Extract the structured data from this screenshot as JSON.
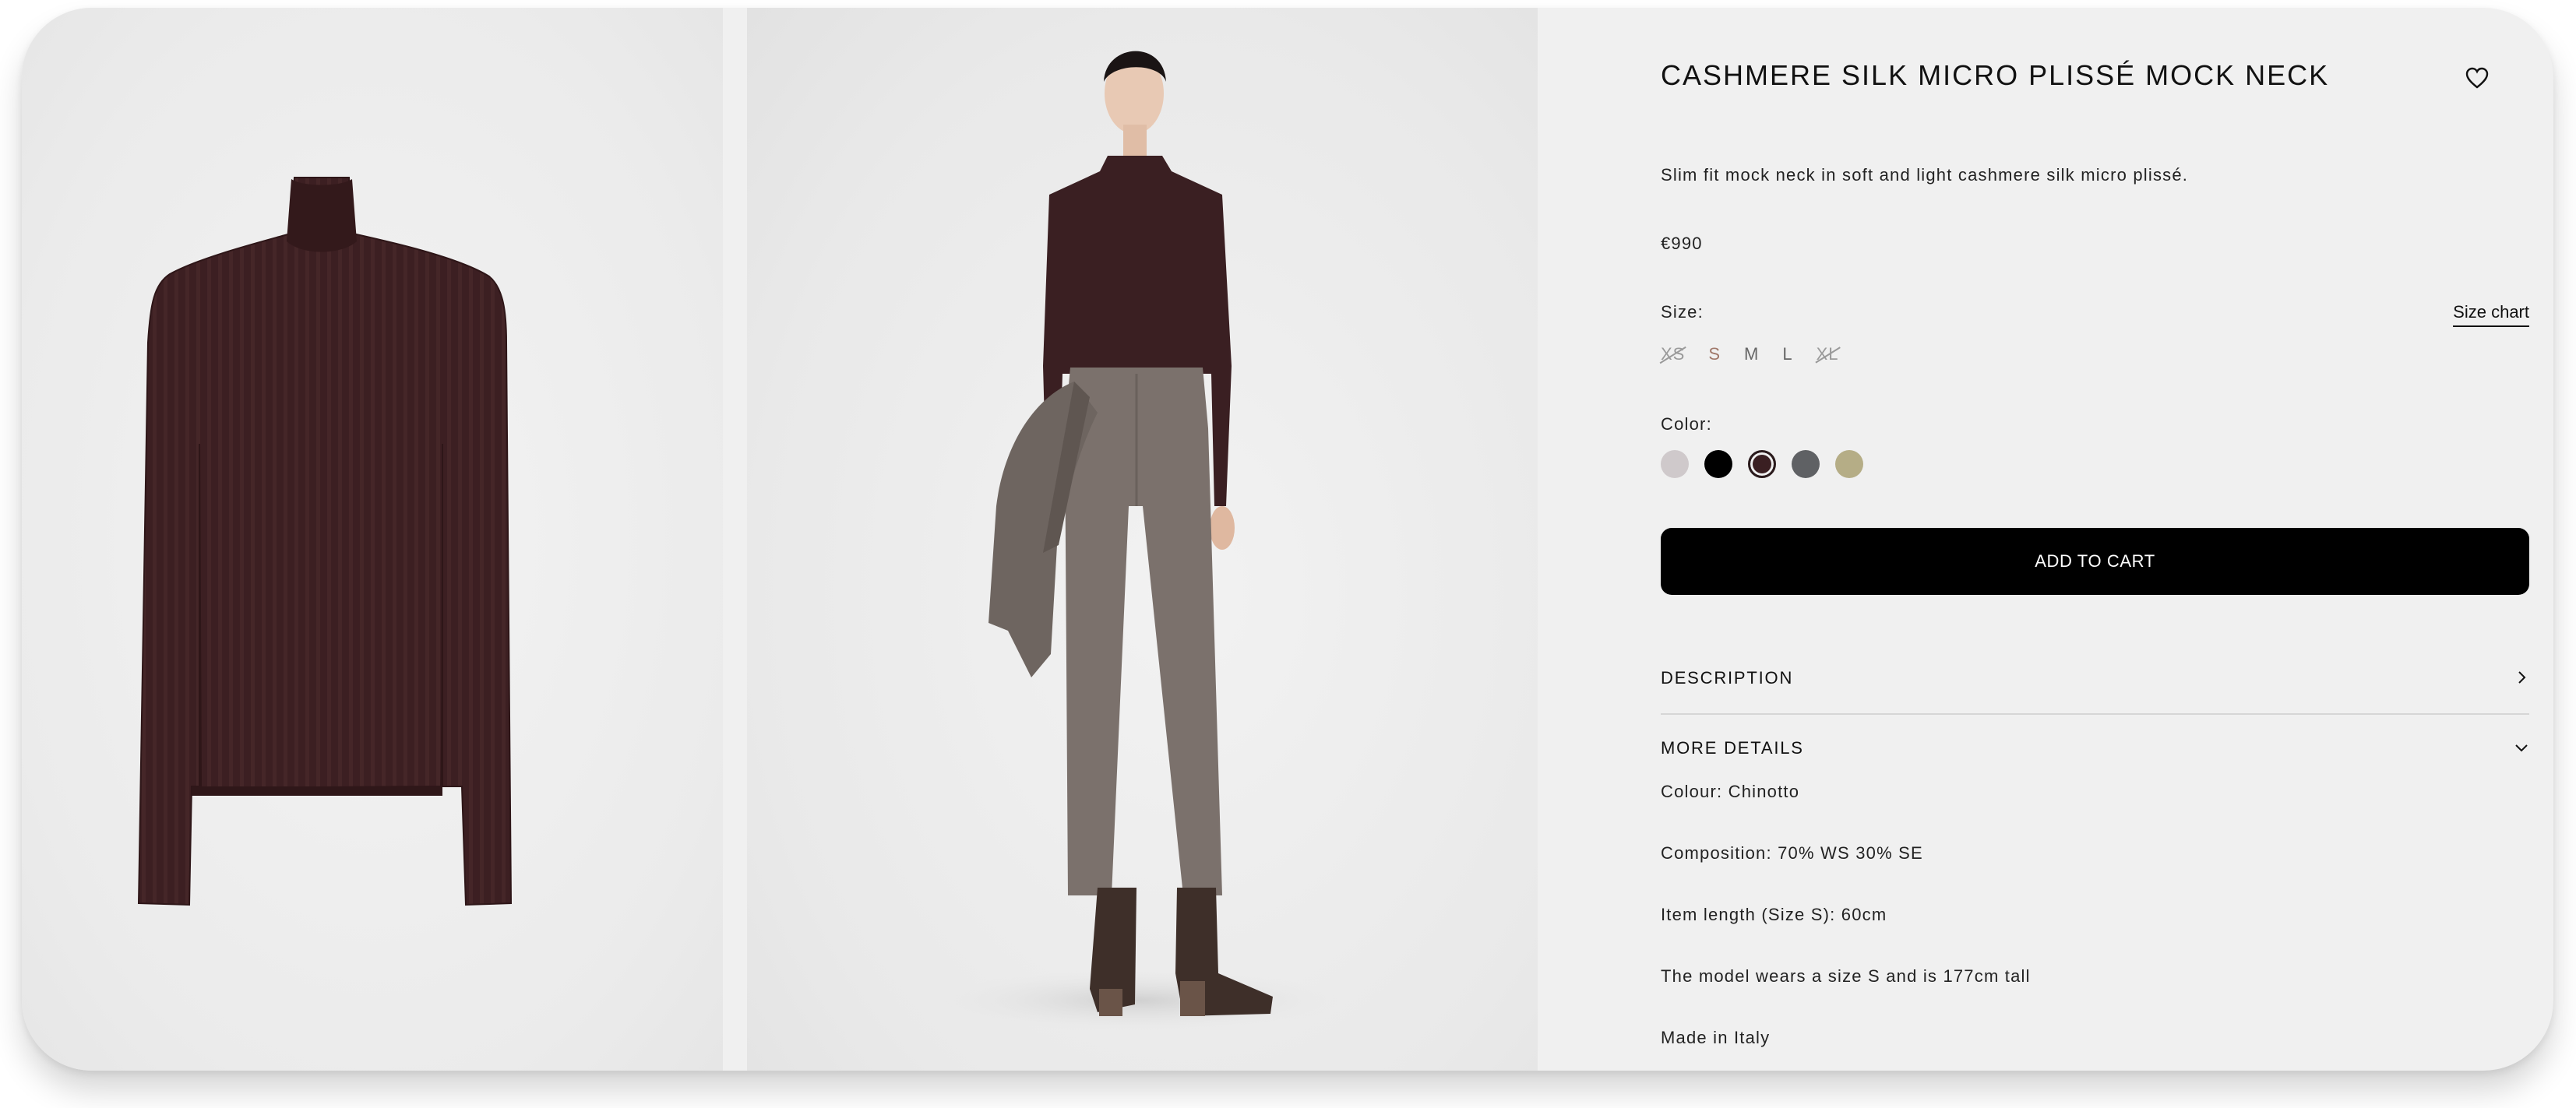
{
  "product": {
    "title": "CASHMERE SILK MICRO PLISSÉ MOCK NECK",
    "description": "Slim fit mock neck in soft and light cashmere silk micro plissé.",
    "price": "€990"
  },
  "size": {
    "label": "Size:",
    "chart_link": "Size chart",
    "options": [
      {
        "label": "XS",
        "available": false
      },
      {
        "label": "S",
        "available": true,
        "selected": true
      },
      {
        "label": "M",
        "available": true
      },
      {
        "label": "L",
        "available": true
      },
      {
        "label": "XL",
        "available": false
      }
    ]
  },
  "color": {
    "label": "Color:",
    "swatches": [
      {
        "hex": "#cfc9cb"
      },
      {
        "hex": "#000000"
      },
      {
        "hex": "#3a1f22",
        "selected": true
      },
      {
        "hex": "#5f6164"
      },
      {
        "hex": "#b5ad86"
      }
    ]
  },
  "cart": {
    "label": "ADD TO CART"
  },
  "accordion": {
    "description_label": "DESCRIPTION",
    "more_details_label": "MORE DETAILS"
  },
  "details": [
    "Colour: Chinotto",
    "Composition: 70% WS 30% SE",
    "Item length (Size S): 60cm",
    "The model wears a size S and is 177cm tall",
    "Made in Italy"
  ],
  "icons": {
    "favorite": "heart-icon",
    "description_toggle": "chevron-right-icon",
    "more_details_toggle": "chevron-down-icon"
  }
}
